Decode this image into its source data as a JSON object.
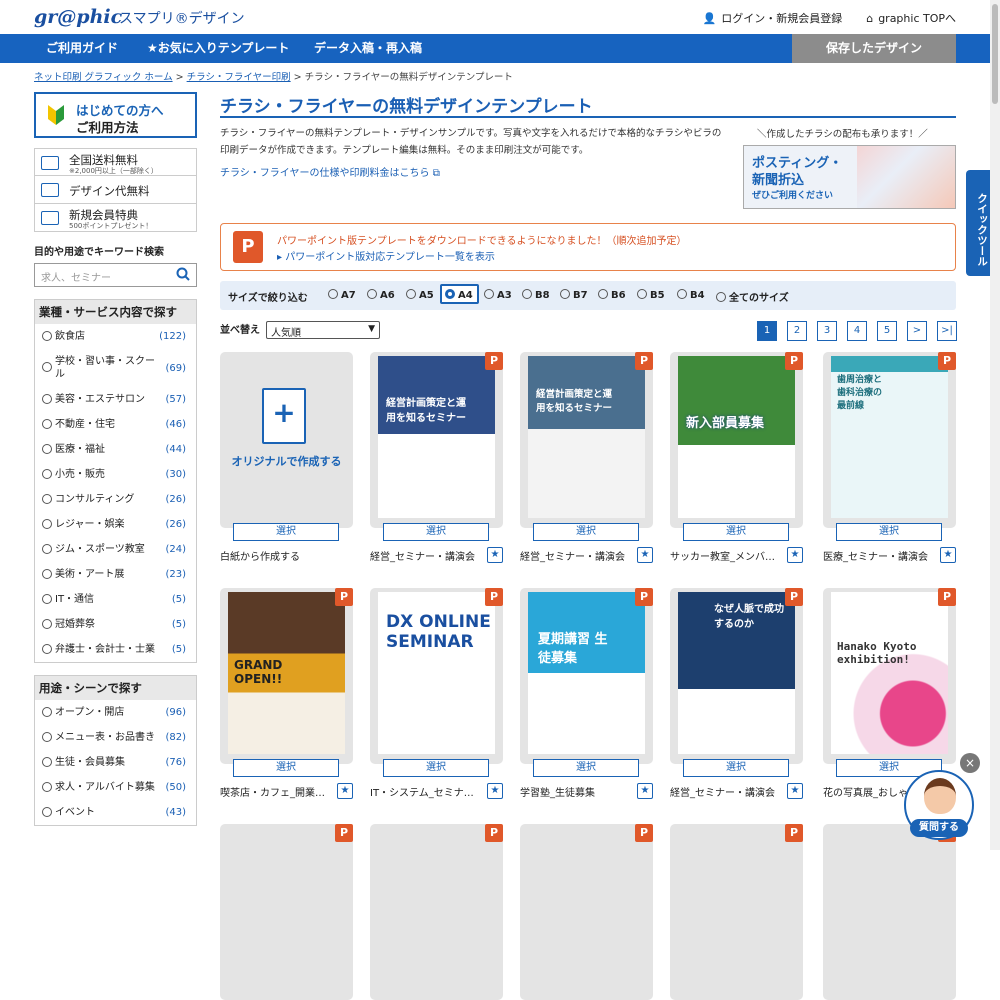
{
  "header": {
    "logo": "gr@phic",
    "logo_sub": "スマプリ®デザイン",
    "login": "ログイン・新規会員登録",
    "top": "graphic TOPへ"
  },
  "nav": {
    "guide": "ご利用ガイド",
    "fav": "★お気に入りテンプレート",
    "data": "データ入稿・再入稿",
    "saved": "保存したデザイン"
  },
  "breadcrumb": {
    "home": "ネット印刷 グラフィック ホーム",
    "sep1": ">",
    "flyer": "チラシ・フライヤー印刷",
    "sep2": ">",
    "current": "チラシ・フライヤーの無料デザインテンプレート"
  },
  "sidebar": {
    "first_line1": "はじめての方へ",
    "first_line2": "ご利用方法",
    "features": [
      {
        "title": "全国送料無料",
        "sub": "※2,000円以上（一部除く）"
      },
      {
        "title": "デザイン代無料",
        "sub": ""
      },
      {
        "title": "新規会員特典",
        "sub": "500ポイントプレゼント！"
      }
    ],
    "search_label": "目的や用途でキーワード検索",
    "search_placeholder": "求人、セミナー",
    "cat1_title": "業種・サービス内容で探す",
    "cat1": [
      {
        "label": "飲食店",
        "count": "(122)"
      },
      {
        "label": "学校・習い事・スクール",
        "count": "(69)"
      },
      {
        "label": "美容・エステサロン",
        "count": "(57)"
      },
      {
        "label": "不動産・住宅",
        "count": "(46)"
      },
      {
        "label": "医療・福祉",
        "count": "(44)"
      },
      {
        "label": "小売・販売",
        "count": "(30)"
      },
      {
        "label": "コンサルティング",
        "count": "(26)"
      },
      {
        "label": "レジャー・娯楽",
        "count": "(26)"
      },
      {
        "label": "ジム・スポーツ教室",
        "count": "(24)"
      },
      {
        "label": "美術・アート展",
        "count": "(23)"
      },
      {
        "label": "IT・通信",
        "count": "(5)"
      },
      {
        "label": "冠婚葬祭",
        "count": "(5)"
      },
      {
        "label": "弁護士・会計士・士業",
        "count": "(5)"
      }
    ],
    "cat2_title": "用途・シーンで探す",
    "cat2": [
      {
        "label": "オープン・開店",
        "count": "(96)"
      },
      {
        "label": "メニュー表・お品書き",
        "count": "(82)"
      },
      {
        "label": "生徒・会員募集",
        "count": "(76)"
      },
      {
        "label": "求人・アルバイト募集",
        "count": "(50)"
      },
      {
        "label": "イベント",
        "count": "(43)"
      }
    ]
  },
  "main": {
    "title": "チラシ・フライヤーの無料デザインテンプレート",
    "desc": "チラシ・フライヤーの無料テンプレート・デザインサンプルです。写真や文字を入れるだけで本格的なチラシやビラの印刷データが作成できます。テンプレート編集は無料。そのまま印刷注文が可能です。",
    "spec_link": "チラシ・フライヤーの仕様や印刷料金はこちら",
    "banner_note": "＼作成したチラシの配布も承ります！／",
    "banner_l1": "ポスティング・",
    "banner_l2": "新聞折込",
    "banner_l3": "ぜひご利用ください",
    "ppt_line1": "パワーポイント版テンプレートをダウンロードできるようになりました！（順次追加予定）",
    "ppt_line2": "▸ パワーポイント版対応テンプレート一覧を表示",
    "size_label": "サイズで絞り込む",
    "sizes": [
      "A7",
      "A6",
      "A5",
      "A4",
      "A3",
      "B8",
      "B7",
      "B6",
      "B5",
      "B4",
      "全てのサイズ"
    ],
    "sort_label": "並べ替え",
    "sort_value": "人気順",
    "pages": [
      "1",
      "2",
      "3",
      "4",
      "5",
      ">",
      ">|"
    ],
    "select_label": "選択",
    "original_label": "オリジナルで作成する",
    "templates": [
      {
        "name": "白紙から作成する"
      },
      {
        "name": "経営_セミナー・講演会",
        "poster": "経営計画策定と運用を知るセミナー",
        "color": "#2f4f8a"
      },
      {
        "name": "経営_セミナー・講演会",
        "poster": "経営計画策定と運用を知るセミナー",
        "color": "#4a6f8f"
      },
      {
        "name": "サッカー教室_メンバー募集",
        "poster": "新入部員募集",
        "color": "#2c7a3a"
      },
      {
        "name": "医療_セミナー・講演会",
        "poster": "歯周治療と歯科治療の最前線",
        "color": "#3aa8b8"
      },
      {
        "name": "喫茶店・カフェ_開業・オープン",
        "poster": "GRAND OPEN!!",
        "color": "#e0a020"
      },
      {
        "name": "IT・システム_セミナー・講演会",
        "poster": "DX ONLINE SEMINAR",
        "color": "#1a4fa0"
      },
      {
        "name": "学習塾_生徒募集",
        "poster": "夏期講習 生徒募集",
        "color": "#2aa7d8"
      },
      {
        "name": "経営_セミナー・講演会",
        "poster": "なぜ人脈で成功するのか",
        "color": "#1d3f6e"
      },
      {
        "name": "花の写真展_おしゃれ",
        "poster": "Hanako Kyoto exhibition!",
        "color": "#d84a8a"
      }
    ]
  },
  "quick": "クイックツール",
  "chat_label": "質問する",
  "chat_close": "×",
  "star": "★",
  "ppt_icon": "P"
}
